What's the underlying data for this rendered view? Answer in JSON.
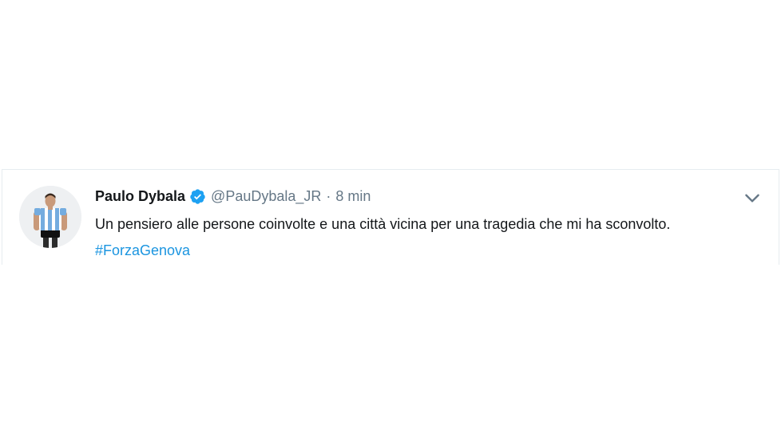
{
  "tweet": {
    "author_name": "Paulo Dybala",
    "handle": "@PauDybala_JR",
    "separator": "·",
    "time": "8 min",
    "text": "Un pensiero alle persone coinvolte e una città vicina per una tragedia che mi ha sconvolto. ",
    "hashtag": "#ForzaGenova",
    "verified_icon": "verified-badge-icon",
    "menu_icon": "chevron-down-icon"
  },
  "colors": {
    "name": "#14171a",
    "meta": "#657786",
    "link": "#1b95e0",
    "verified": "#1da1f2",
    "border": "#e6ecf0"
  }
}
